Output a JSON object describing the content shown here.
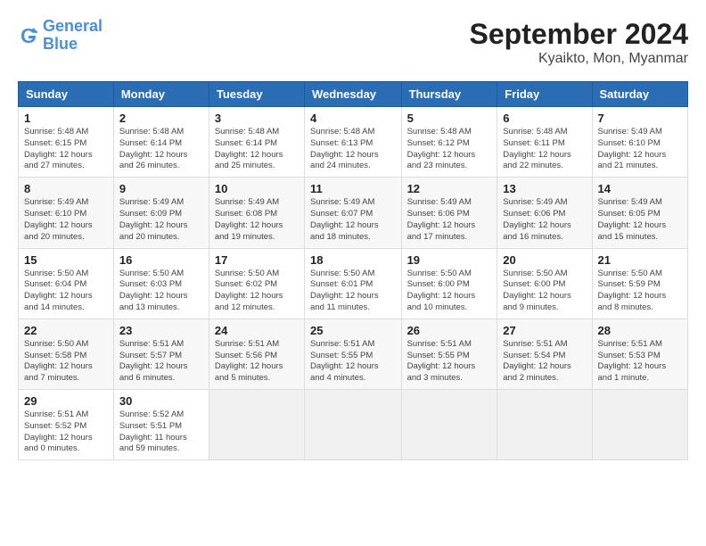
{
  "header": {
    "logo_general": "General",
    "logo_blue": "Blue",
    "month_title": "September 2024",
    "location": "Kyaikto, Mon, Myanmar"
  },
  "columns": [
    "Sunday",
    "Monday",
    "Tuesday",
    "Wednesday",
    "Thursday",
    "Friday",
    "Saturday"
  ],
  "weeks": [
    [
      {
        "day": "1",
        "info": "Sunrise: 5:48 AM\nSunset: 6:15 PM\nDaylight: 12 hours\nand 27 minutes."
      },
      {
        "day": "2",
        "info": "Sunrise: 5:48 AM\nSunset: 6:14 PM\nDaylight: 12 hours\nand 26 minutes."
      },
      {
        "day": "3",
        "info": "Sunrise: 5:48 AM\nSunset: 6:14 PM\nDaylight: 12 hours\nand 25 minutes."
      },
      {
        "day": "4",
        "info": "Sunrise: 5:48 AM\nSunset: 6:13 PM\nDaylight: 12 hours\nand 24 minutes."
      },
      {
        "day": "5",
        "info": "Sunrise: 5:48 AM\nSunset: 6:12 PM\nDaylight: 12 hours\nand 23 minutes."
      },
      {
        "day": "6",
        "info": "Sunrise: 5:48 AM\nSunset: 6:11 PM\nDaylight: 12 hours\nand 22 minutes."
      },
      {
        "day": "7",
        "info": "Sunrise: 5:49 AM\nSunset: 6:10 PM\nDaylight: 12 hours\nand 21 minutes."
      }
    ],
    [
      {
        "day": "8",
        "info": "Sunrise: 5:49 AM\nSunset: 6:10 PM\nDaylight: 12 hours\nand 20 minutes."
      },
      {
        "day": "9",
        "info": "Sunrise: 5:49 AM\nSunset: 6:09 PM\nDaylight: 12 hours\nand 20 minutes."
      },
      {
        "day": "10",
        "info": "Sunrise: 5:49 AM\nSunset: 6:08 PM\nDaylight: 12 hours\nand 19 minutes."
      },
      {
        "day": "11",
        "info": "Sunrise: 5:49 AM\nSunset: 6:07 PM\nDaylight: 12 hours\nand 18 minutes."
      },
      {
        "day": "12",
        "info": "Sunrise: 5:49 AM\nSunset: 6:06 PM\nDaylight: 12 hours\nand 17 minutes."
      },
      {
        "day": "13",
        "info": "Sunrise: 5:49 AM\nSunset: 6:06 PM\nDaylight: 12 hours\nand 16 minutes."
      },
      {
        "day": "14",
        "info": "Sunrise: 5:49 AM\nSunset: 6:05 PM\nDaylight: 12 hours\nand 15 minutes."
      }
    ],
    [
      {
        "day": "15",
        "info": "Sunrise: 5:50 AM\nSunset: 6:04 PM\nDaylight: 12 hours\nand 14 minutes."
      },
      {
        "day": "16",
        "info": "Sunrise: 5:50 AM\nSunset: 6:03 PM\nDaylight: 12 hours\nand 13 minutes."
      },
      {
        "day": "17",
        "info": "Sunrise: 5:50 AM\nSunset: 6:02 PM\nDaylight: 12 hours\nand 12 minutes."
      },
      {
        "day": "18",
        "info": "Sunrise: 5:50 AM\nSunset: 6:01 PM\nDaylight: 12 hours\nand 11 minutes."
      },
      {
        "day": "19",
        "info": "Sunrise: 5:50 AM\nSunset: 6:00 PM\nDaylight: 12 hours\nand 10 minutes."
      },
      {
        "day": "20",
        "info": "Sunrise: 5:50 AM\nSunset: 6:00 PM\nDaylight: 12 hours\nand 9 minutes."
      },
      {
        "day": "21",
        "info": "Sunrise: 5:50 AM\nSunset: 5:59 PM\nDaylight: 12 hours\nand 8 minutes."
      }
    ],
    [
      {
        "day": "22",
        "info": "Sunrise: 5:50 AM\nSunset: 5:58 PM\nDaylight: 12 hours\nand 7 minutes."
      },
      {
        "day": "23",
        "info": "Sunrise: 5:51 AM\nSunset: 5:57 PM\nDaylight: 12 hours\nand 6 minutes."
      },
      {
        "day": "24",
        "info": "Sunrise: 5:51 AM\nSunset: 5:56 PM\nDaylight: 12 hours\nand 5 minutes."
      },
      {
        "day": "25",
        "info": "Sunrise: 5:51 AM\nSunset: 5:55 PM\nDaylight: 12 hours\nand 4 minutes."
      },
      {
        "day": "26",
        "info": "Sunrise: 5:51 AM\nSunset: 5:55 PM\nDaylight: 12 hours\nand 3 minutes."
      },
      {
        "day": "27",
        "info": "Sunrise: 5:51 AM\nSunset: 5:54 PM\nDaylight: 12 hours\nand 2 minutes."
      },
      {
        "day": "28",
        "info": "Sunrise: 5:51 AM\nSunset: 5:53 PM\nDaylight: 12 hours\nand 1 minute."
      }
    ],
    [
      {
        "day": "29",
        "info": "Sunrise: 5:51 AM\nSunset: 5:52 PM\nDaylight: 12 hours\nand 0 minutes."
      },
      {
        "day": "30",
        "info": "Sunrise: 5:52 AM\nSunset: 5:51 PM\nDaylight: 11 hours\nand 59 minutes."
      },
      {
        "day": "",
        "info": ""
      },
      {
        "day": "",
        "info": ""
      },
      {
        "day": "",
        "info": ""
      },
      {
        "day": "",
        "info": ""
      },
      {
        "day": "",
        "info": ""
      }
    ]
  ]
}
